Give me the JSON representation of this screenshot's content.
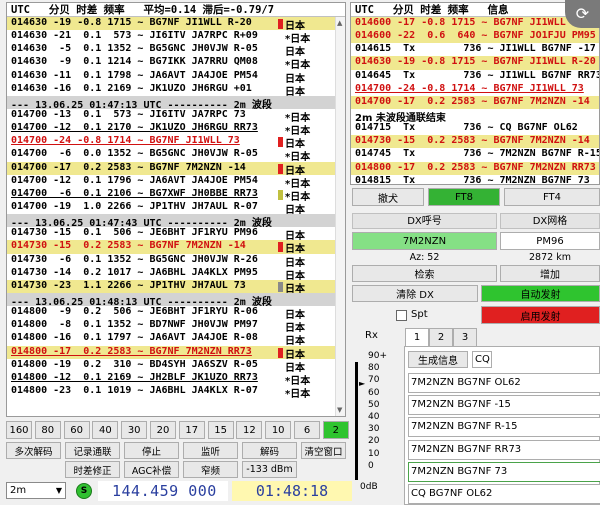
{
  "left": {
    "header": "UTC   分贝 时差 频率   平均=0.14 滞后=-0.79/7",
    "rows": [
      {
        "t": "014630 -19 -0.8 1715 ~ BG7NF JI1WLL R-20",
        "c": "日本",
        "mark": "#e02020",
        "style": "hl"
      },
      {
        "t": "014630 -21  0.1  573 ~ JI6ITV JA7RPC R+09",
        "c": "*日本",
        "mark": "",
        "style": ""
      },
      {
        "t": "014630  -5  0.1 1352 ~ BG5GNC JH0VJW R-05",
        "c": "日本",
        "mark": "",
        "style": ""
      },
      {
        "t": "014630  -9  0.1 1214 ~ BG7IKK JA7RRU QM08",
        "c": "*日本",
        "mark": "",
        "style": ""
      },
      {
        "t": "014630 -11  0.1 1798 ~ JA6AVT JA4JOE PM54",
        "c": "日本",
        "mark": "",
        "style": ""
      },
      {
        "t": "014630 -16  0.1 2169 ~ JK1UZO JH6RGU +01",
        "c": "日本",
        "mark": "",
        "style": ""
      },
      {
        "t": "--- 13.06.25 01:47:13 UTC ---------- 2m 波段",
        "c": "",
        "mark": "",
        "style": "sep"
      },
      {
        "t": "014700 -13  0.1  573 ~ JI6ITV JA7RPC 73",
        "c": "*日本",
        "mark": "",
        "style": ""
      },
      {
        "t": "014700 -12  0.1 2170 ~ JK1UZO JH6RGU RR73",
        "c": "*日本",
        "mark": "",
        "style": "u"
      },
      {
        "t": "014700 -24 -0.8 1714 ~ BG7NF JI1WLL 73",
        "c": "日本",
        "mark": "#e02020",
        "style": "red u"
      },
      {
        "t": "014700  -6  0.0 1352 ~ BG5GNC JH0VJW R-05",
        "c": "*日本",
        "mark": "",
        "style": ""
      },
      {
        "t": "014700 -17  0.2 2583 ~ BG7NF 7M2NZN -14",
        "c": "日本",
        "mark": "#e02020",
        "style": "hl"
      },
      {
        "t": "014700 -12  0.1 1796 ~ JA6AVT JA4JOE PM54",
        "c": "*日本",
        "mark": "",
        "style": ""
      },
      {
        "t": "014700  -6  0.1 2106 ~ BG7XWF JH0BBE RR73",
        "c": "*日本",
        "mark": "#c0c040",
        "style": "u"
      },
      {
        "t": "014700 -19  1.0 2266 ~ JP1THV JH7AUL R-07",
        "c": "日本",
        "mark": "",
        "style": ""
      },
      {
        "t": "--- 13.06.25 01:47:43 UTC ---------- 2m 波段",
        "c": "",
        "mark": "",
        "style": "sep"
      },
      {
        "t": "014730 -15  0.1  506 ~ JE6BHT JF1RYU PM96",
        "c": "日本",
        "mark": "",
        "style": ""
      },
      {
        "t": "014730 -15  0.2 2583 ~ BG7NF 7M2NZN -14",
        "c": "日本",
        "mark": "#e02020",
        "style": "hl red"
      },
      {
        "t": "014730  -6  0.1 1352 ~ BG5GNC JH0VJW R-26",
        "c": "日本",
        "mark": "",
        "style": ""
      },
      {
        "t": "014730 -14  0.2 1017 ~ JA6BHL JA4KLX PM95",
        "c": "日本",
        "mark": "",
        "style": ""
      },
      {
        "t": "014730 -23  1.1 2266 ~ JP1THV JH7AUL 73",
        "c": "日本",
        "mark": "#8a8a8a",
        "style": "hl"
      },
      {
        "t": "--- 13.06.25 01:48:13 UTC ---------- 2m 波段",
        "c": "",
        "mark": "",
        "style": "sep"
      },
      {
        "t": "014800  -9  0.2  506 ~ JE6BHT JF1RYU R-06",
        "c": "日本",
        "mark": "",
        "style": ""
      },
      {
        "t": "014800  -8  0.1 1352 ~ BD7NWF JH0VJW PM97",
        "c": "日本",
        "mark": "",
        "style": ""
      },
      {
        "t": "014800 -16  0.1 1797 ~ JA6AVT JA4JOE R-08",
        "c": "日本",
        "mark": "",
        "style": ""
      },
      {
        "t": "014800 -17  0.2 2583 ~ BG7NF 7M2NZN RR73",
        "c": "日本",
        "mark": "#e02020",
        "style": "hl red u"
      },
      {
        "t": "014800 -19  0.2  310 ~ BD4SYH JA6SZV R-05",
        "c": "日本",
        "mark": "",
        "style": ""
      },
      {
        "t": "014800 -12  0.1 2169 ~ JH2BLF JK1UZO RR73",
        "c": "*日本",
        "mark": "",
        "style": "u"
      },
      {
        "t": "014800 -23  0.1 1019 ~ JA6BHL JA4KLX R-07",
        "c": "*日本",
        "mark": "",
        "style": ""
      }
    ]
  },
  "right": {
    "header": "UTC   分贝 时差 频率   信息",
    "rows": [
      {
        "t": "014600 -17 -0.8 1715 ~ BG7NF JI1WLL",
        "c": "",
        "style": "hl red"
      },
      {
        "t": "014600 -22  0.6  640 ~ BG7NF JO1FJU PM95",
        "c": "",
        "style": "hl red"
      },
      {
        "t": "014615  Tx        736 ~ JI1WLL BG7NF -17",
        "c": "",
        "style": ""
      },
      {
        "t": "014630 -19 -0.8 1715 ~ BG7NF JI1WLL R-20",
        "c": "",
        "style": "hl red"
      },
      {
        "t": "014645  Tx        736 ~ JI1WLL BG7NF RR73",
        "c": "",
        "style": ""
      },
      {
        "t": "014700 -24 -0.8 1714 ~ BG7NF JI1WLL 73",
        "c": "",
        "style": "red u"
      },
      {
        "t": "014700 -17  0.2 2583 ~ BG7NF 7M2NZN -14",
        "c": "",
        "style": "hl red"
      },
      {
        "t": "2m 未波段通联结束",
        "c": "",
        "style": "note"
      },
      {
        "t": "014715  Tx        736 ~ CQ BG7NF OL62",
        "c": "",
        "style": ""
      },
      {
        "t": "014730 -15  0.2 2583 ~ BG7NF 7M2NZN -14",
        "c": "",
        "style": "hl red"
      },
      {
        "t": "014745  Tx        736 ~ 7M2NZN BG7NF R-15",
        "c": "",
        "style": ""
      },
      {
        "t": "014800 -17  0.2 2583 ~ BG7NF 7M2NZN RR73",
        "c": "",
        "style": "hl red"
      },
      {
        "t": "014815  Tx        736 ~ 7M2NZN BG7NF 73",
        "c": "",
        "style": ""
      }
    ]
  },
  "bands": [
    "160",
    "80",
    "60",
    "40",
    "30",
    "20",
    "17",
    "15",
    "12",
    "10",
    "6",
    "2"
  ],
  "active_band": "2",
  "controls_row1": [
    "多次解码",
    "记录通联",
    "停止",
    "监听",
    "解码",
    "清空窗口"
  ],
  "controls_row2": [
    "时差修正",
    "AGC补偿",
    "窄频",
    "-133 dBm"
  ],
  "bottom": {
    "band": "2m",
    "s_label": "S",
    "frequency": "144.459  000",
    "utc_time": "01:48:18"
  },
  "mode_buttons": {
    "tune": "撤犬",
    "ft8": "FT8",
    "ft4": "FT4"
  },
  "dx": {
    "call_label": "DX呼号",
    "grid_label": "DX网格",
    "call": "7M2NZN",
    "grid": "PM96",
    "az": "Az: 52",
    "dist": "2872 km",
    "lookup": "检索",
    "add": "增加",
    "clear_dx": "清除 DX",
    "auto_tx": "自动发射",
    "spt": "Spt",
    "enable_tx": "启用发射"
  },
  "rx_label": "Rx",
  "tabs": [
    "1",
    "2",
    "3"
  ],
  "active_tab": "1",
  "gen_msg": "生成信息",
  "cq_label": "CQ",
  "meter": {
    "labels": [
      "90+",
      "80",
      "70",
      "60",
      "50",
      "40",
      "30",
      "20",
      "10",
      "0",
      "0dB"
    ],
    "level": "65"
  },
  "messages": [
    "7M2NZN BG7NF OL62",
    "7M2NZN BG7NF -15",
    "7M2NZN BG7NF R-15",
    "7M2NZN BG7NF RR73",
    "7M2NZN BG7NF 73",
    "CQ BG7NF OL62"
  ],
  "selected_message": "7M2NZN BG7NF 73",
  "colors": {
    "highlight": "#f0e890",
    "red_text": "#d01010",
    "green": "#2fc42f",
    "red": "#e02020",
    "freq_blue": "#2a3f9f"
  }
}
